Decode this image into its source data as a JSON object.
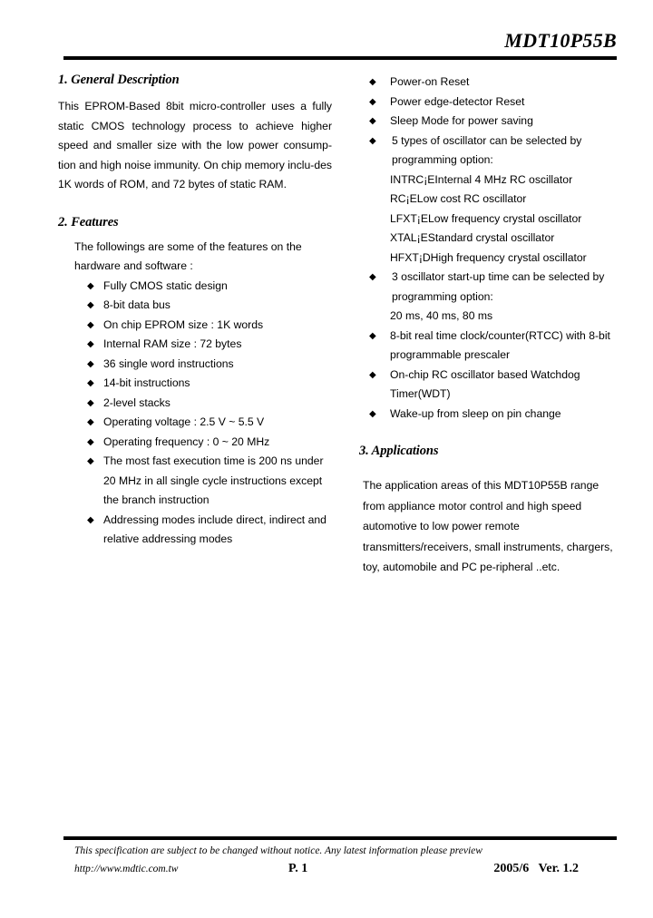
{
  "header": {
    "title": "MDT10P55B"
  },
  "sections": {
    "general_description": {
      "heading": "1. General Description",
      "paragraph": "This EPROM-Based 8bit micro-controller uses a fully static CMOS technology process to achieve higher speed and smaller size with the low power consump-tion and high noise immunity. On chip memory inclu-des 1K words of ROM, and 72 bytes of static RAM."
    },
    "features": {
      "heading": "2. Features",
      "intro_line1": "The followings are some of the features on the",
      "intro_line2": "hardware and software :",
      "items": [
        "Fully CMOS static design",
        "8-bit data bus",
        "On chip EPROM size : 1K words",
        "Internal RAM size : 72 bytes",
        "36 single word instructions",
        "14-bit instructions",
        "2-level stacks",
        "Operating voltage : 2.5 V ~ 5.5 V",
        "Operating frequency : 0 ~ 20 MHz"
      ],
      "item_exec_time": "The most fast execution time is 200 ns under 20 MHz in all single cycle instructions except the branch instruction",
      "item_addressing": "Addressing modes include direct, indirect and relative addressing modes"
    },
    "features_right": {
      "item_power_on_reset": "Power-on Reset",
      "item_power_edge_reset": "Power edge-detector Reset",
      "item_sleep_mode": "Sleep Mode for power saving",
      "oscillator": {
        "line1": "5 types of oscillator can be selected by",
        "line2": "programming option:",
        "types": [
          "INTRC¡EInternal 4 MHz RC oscillator",
          "RC¡ELow cost RC oscillator",
          "LFXT¡ELow frequency crystal oscillator",
          "XTAL¡EStandard crystal oscillator",
          "HFXT¡DHigh frequency crystal oscillator"
        ]
      },
      "startup": {
        "line1": "3 oscillator start-up time can be selected by",
        "line2": "programming option:",
        "line3": "20 ms, 40 ms, 80 ms"
      },
      "item_rtcc": "8-bit real time clock/counter(RTCC) with 8-bit programmable prescaler",
      "item_wdt": "On-chip RC oscillator based Watchdog Timer(WDT)",
      "item_wakeup": "Wake-up from sleep on pin change"
    },
    "applications": {
      "heading": "3. Applications",
      "line1": "The application areas of this MDT10P55B range",
      "line2": "from appliance motor control and high speed",
      "line3": "automotive to low power remote",
      "line4": "transmitters/receivers, small instruments, chargers,",
      "line5": "toy, automobile and PC pe-ripheral ..etc."
    }
  },
  "footer": {
    "notice": "This specification are subject to be changed without notice. Any latest information please preview",
    "url": "http://www.mdtic.com.tw",
    "page": "P. 1",
    "version": "2005/6   Ver. 1.2"
  },
  "icons": {
    "bullet": "◆"
  }
}
